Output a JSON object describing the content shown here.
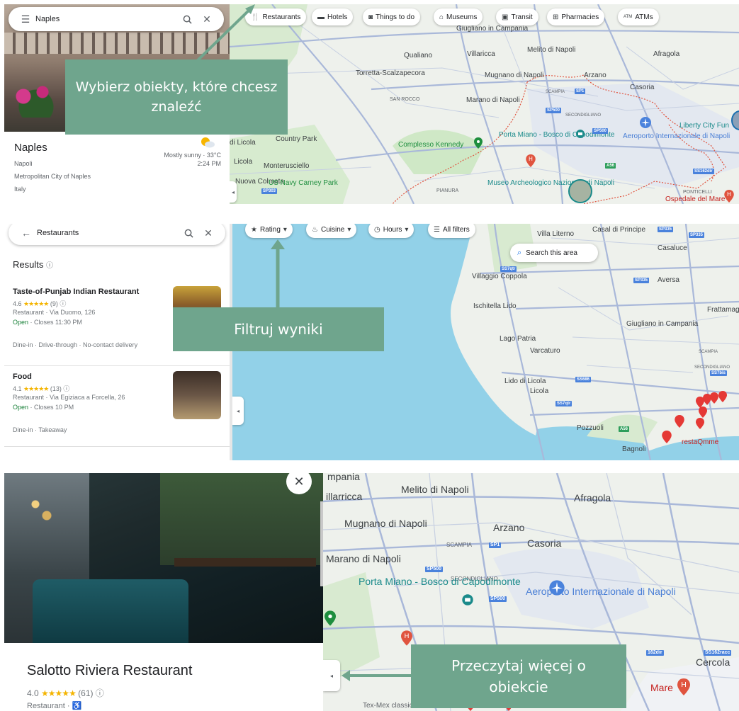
{
  "panel1": {
    "search": {
      "value": "Naples"
    },
    "place": {
      "name": "Naples",
      "line1": "Napoli",
      "line2": "Metropolitan City of Naples",
      "line3": "Italy",
      "weather": "Mostly sunny · 33°C",
      "time": "2:24 PM"
    },
    "chips": [
      {
        "icon": "fork-knife-icon",
        "label": "Restaurants"
      },
      {
        "icon": "bed-icon",
        "label": "Hotels"
      },
      {
        "icon": "camera-icon",
        "label": "Things to do"
      },
      {
        "icon": "museum-icon",
        "label": "Museums"
      },
      {
        "icon": "train-icon",
        "label": "Transit"
      },
      {
        "icon": "pharmacy-icon",
        "label": "Pharmacies"
      },
      {
        "icon": "atm-icon",
        "label": "ATMs"
      }
    ],
    "callout": "Wybierz obiekty, które chcesz znaleźć",
    "map_labels": {
      "giugliano": "Giugliano in Campania",
      "qualiano": "Qualiano",
      "villaricca": "Villaricca",
      "melito": "Melito di Napoli",
      "afragola": "Afragola",
      "torretta": "Torretta-Scalzapecora",
      "mugnano": "Mugnano di Napoli",
      "arzano": "Arzano",
      "casoria": "Casoria",
      "san_rocco": "SAN ROCCO",
      "marano": "Marano di Napoli",
      "scampia": "SCAMPIA",
      "secondigliano": "SECONDIGLIANO",
      "country_park": "Country Park",
      "licola": "di Licola",
      "porta_miano": "Porta Miano - Bosco di Capodimonte",
      "aeroporto": "Aeroporto Internazionale di Napoli",
      "liberty": "Liberty City Fun",
      "complesso": "Complesso Kennedy",
      "licola2": "Licola",
      "monterusciello": "Monterusciello",
      "nuova_colmata": "Nuova Colmata",
      "usnavy": "US Navy Carney Park",
      "pianura": "PIANURA",
      "museo": "Museo Archeologico Nazionale di Napoli",
      "ponticelli": "PONTICELLI",
      "ospedale": "Ospedale del Mare",
      "road_sp1": "SP1",
      "road_sp500": "SP500",
      "road_sp500b": "SP500",
      "road_sp303": "SP303",
      "road_ss162": "SS162dir",
      "road_a56": "A56"
    }
  },
  "panel2": {
    "search": {
      "value": "Restaurants"
    },
    "results_header": "Results",
    "results": [
      {
        "name": "Taste-of-Punjab Indian Restaurant",
        "rating": "4.6",
        "stars": "★★★★★",
        "reviews": "(9)",
        "type_address": "Restaurant · Via Duomo, 126",
        "status": "Open",
        "hours": "· Closes 11:30 PM",
        "services": "Dine-in · Drive-through · No-contact delivery"
      },
      {
        "name": "Food",
        "rating": "4.1",
        "stars": "★★★★★",
        "reviews": "(13)",
        "type_address": "Restaurant · Via Egiziaca a Forcella, 26",
        "status": "Open",
        "hours": "· Closes 10 PM",
        "services": "Dine-in · Takeaway"
      }
    ],
    "filters": [
      {
        "icon": "star-icon",
        "label": "Rating"
      },
      {
        "icon": "cuisine-icon",
        "label": "Cuisine"
      },
      {
        "icon": "clock-icon",
        "label": "Hours"
      },
      {
        "icon": "sliders-icon",
        "label": "All filters"
      }
    ],
    "search_area": "Search this area",
    "callout": "Filtruj wyniki",
    "map_labels": {
      "villa_literno": "Villa Literno",
      "casal": "Casal di Principe",
      "casaluce": "Casaluce",
      "villaggio": "Villaggio Coppola",
      "aversa": "Aversa",
      "ischitella": "Ischitella Lido",
      "frattamaggiore": "Frattamaggi",
      "giugliano": "Giugliano in Campania",
      "lago_patria": "Lago Patria",
      "varcaturo": "Varcaturo",
      "scampia": "SCAMPIA",
      "secondigliano": "SECONDIGLIANO",
      "lido_licola": "Lido di Licola",
      "licola": "Licola",
      "pozzuoli": "Pozzuoli",
      "bagnoli": "Bagnoli",
      "restaqmme": "restaQmme",
      "road_sp335": "SP335",
      "road_sp335b": "SP335",
      "road_ss7qtr": "SS7qtr",
      "road_ss686": "SS686",
      "road_ss7qtr2": "SS7qtr",
      "road_a56": "A56",
      "road_sp335c": "SP335",
      "road_ss7bis": "SS7bis"
    }
  },
  "panel3": {
    "place": {
      "name": "Salotto Riviera Restaurant",
      "rating": "4.0",
      "stars": "★★★★★",
      "reviews": "(61)",
      "category": "Restaurant ·"
    },
    "callout": "Przeczytaj więcej o obiekcie",
    "map_labels": {
      "campania": "mpania",
      "villaricca": "illarricca",
      "melito": "Melito di Napoli",
      "afragola": "Afragola",
      "mugnano": "Mugnano di Napoli",
      "arzano": "Arzano",
      "scampia": "SCAMPIA",
      "casoria": "Casoria",
      "marano": "Marano di Napoli",
      "secondigliano": "SECONDIGLIANO",
      "porta_miano": "Porta Miano - Bosco di Capodimonte",
      "aeroporto": "Aeroporto Internazionale di Napoli",
      "cercola": "Cercola",
      "mare": "Mare",
      "texmex": "Tex-Mex classics in",
      "road_sp1": "SP1",
      "road_sp500": "SP500",
      "road_sp500b": "SP500",
      "road_ss162": "SS162racc",
      "road_162dir": "162dir"
    }
  }
}
